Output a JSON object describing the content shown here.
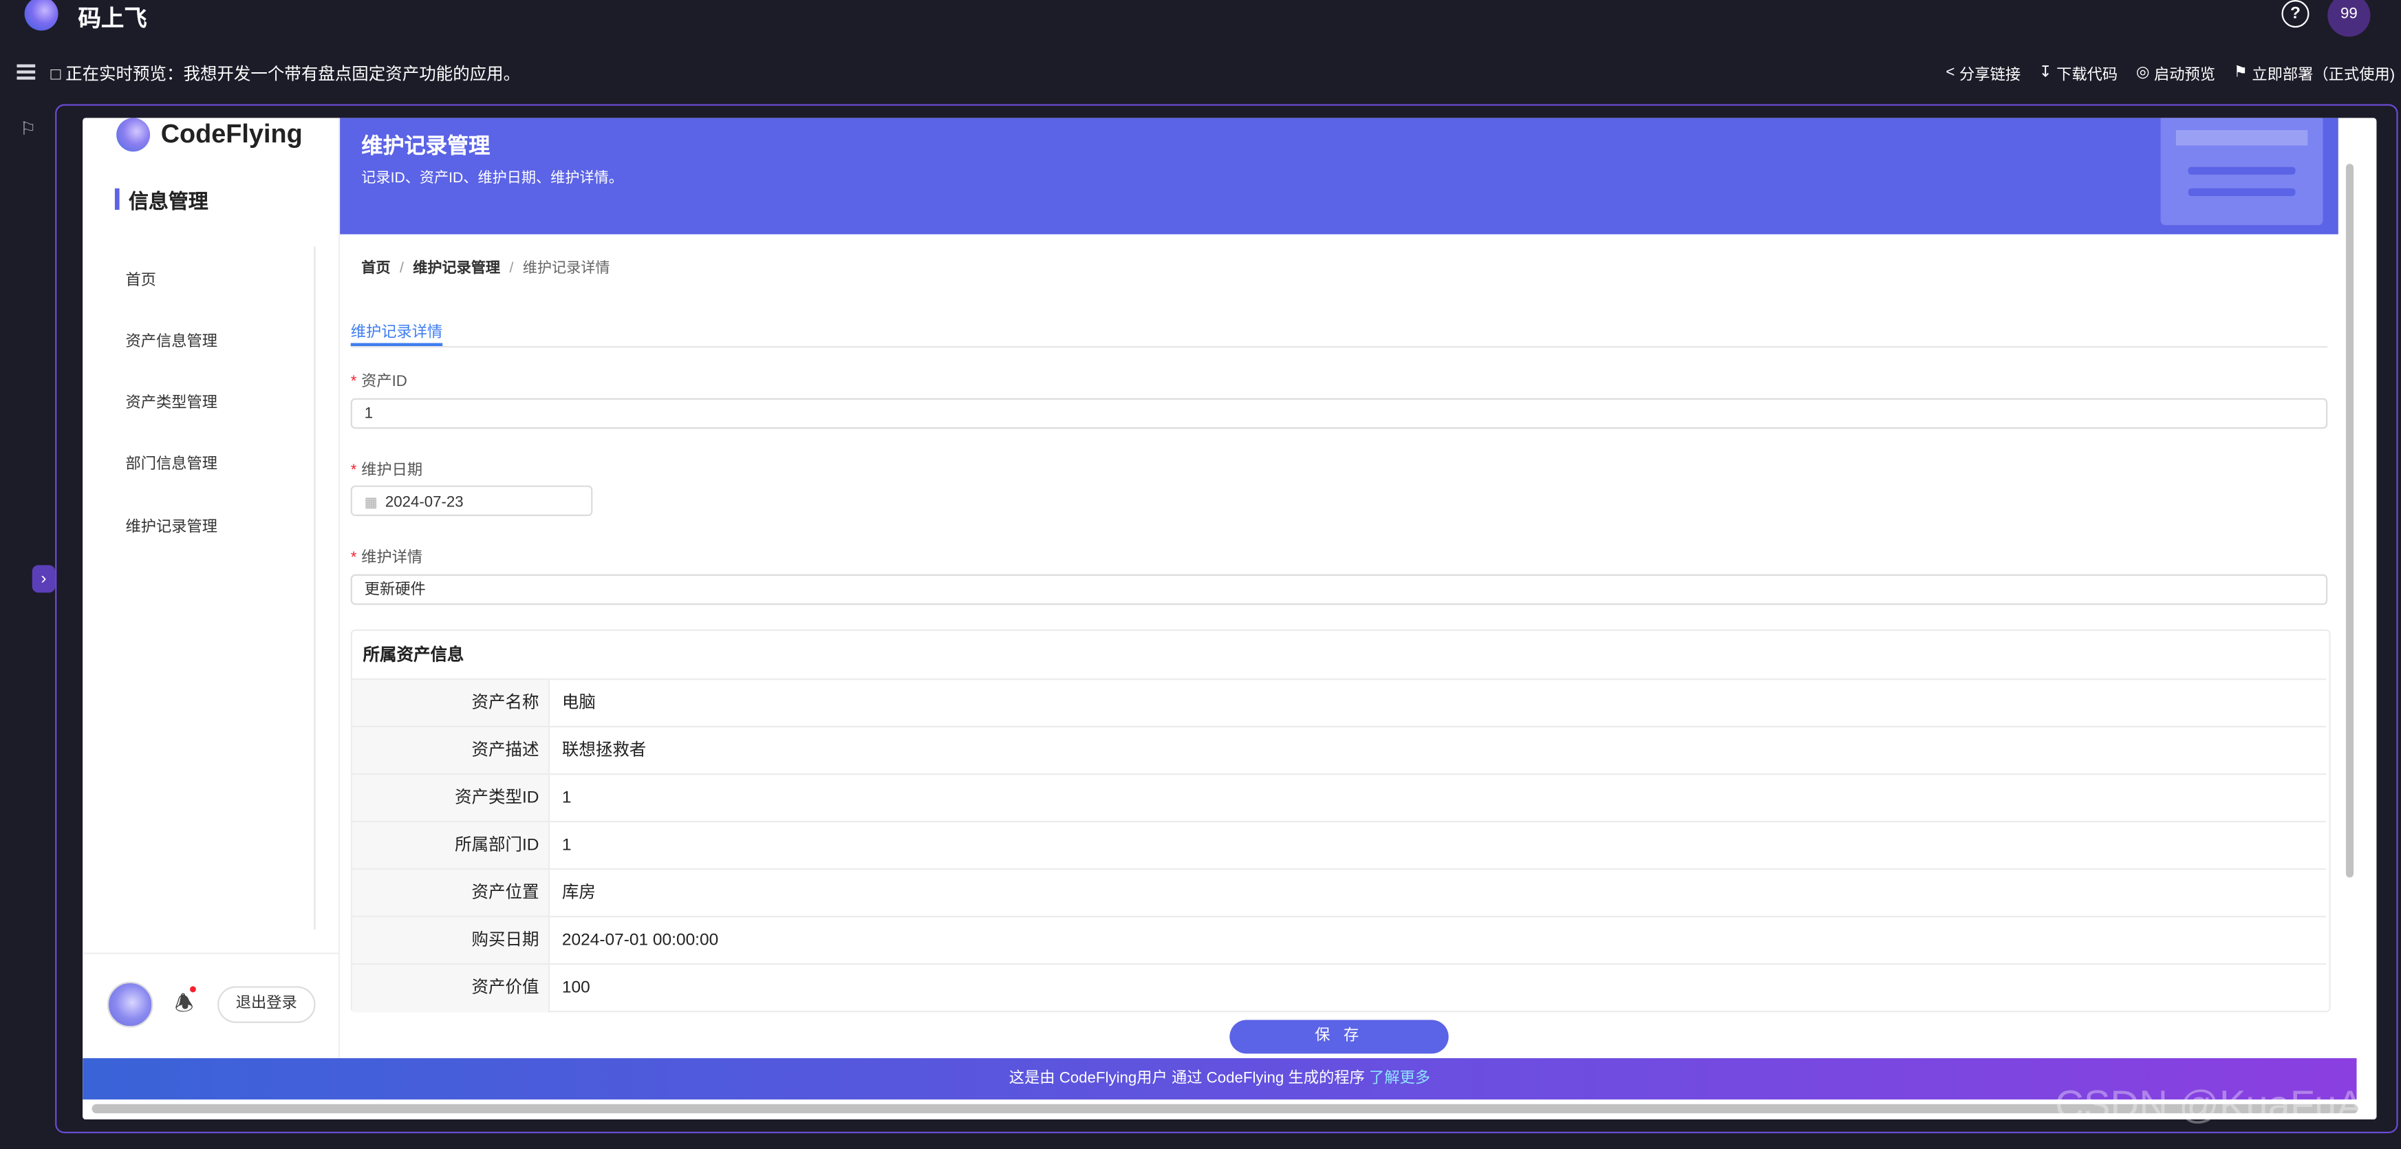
{
  "app": {
    "title": "码上飞",
    "user_badge": "99"
  },
  "toolbar": {
    "preview_text": "正在实时预览：我想开发一个带有盘点固定资产功能的应用。",
    "actions": [
      {
        "label": "分享链接",
        "icon": "share-icon"
      },
      {
        "label": "下载代码",
        "icon": "download-icon"
      },
      {
        "label": "启动预览",
        "icon": "play-icon"
      },
      {
        "label": "立即部署（正式使用)",
        "icon": "flag-icon"
      }
    ]
  },
  "preview": {
    "brand": "CodeFlying",
    "sidebar": {
      "section_title": "信息管理",
      "items": [
        "首页",
        "资产信息管理",
        "资产类型管理",
        "部门信息管理",
        "维护记录管理"
      ],
      "logout_label": "退出登录"
    },
    "banner": {
      "title": "维护记录管理",
      "subtitle": "记录ID、资产ID、维护日期、维护详情。"
    },
    "breadcrumb": [
      "首页",
      "维护记录管理",
      "维护记录详情"
    ],
    "tab": "维护记录详情",
    "form": {
      "asset_id_label": "资产ID",
      "asset_id_value": "1",
      "date_label": "维护日期",
      "date_value": "2024-07-23",
      "detail_label": "维护详情",
      "detail_value": "更新硬件"
    },
    "asset_info": {
      "title": "所属资产信息",
      "rows": [
        {
          "key": "资产名称",
          "value": "电脑"
        },
        {
          "key": "资产描述",
          "value": "联想拯救者"
        },
        {
          "key": "资产类型ID",
          "value": "1"
        },
        {
          "key": "所属部门ID",
          "value": "1"
        },
        {
          "key": "资产位置",
          "value": "库房"
        },
        {
          "key": "购买日期",
          "value": "2024-07-01 00:00:00"
        },
        {
          "key": "资产价值",
          "value": "100"
        }
      ]
    },
    "save_label": "保 存",
    "footer": {
      "text": "这是由 CodeFlying用户 通过 CodeFlying 生成的程序",
      "link": "了解更多"
    }
  },
  "watermark": "CSDN @KuaFuAI"
}
